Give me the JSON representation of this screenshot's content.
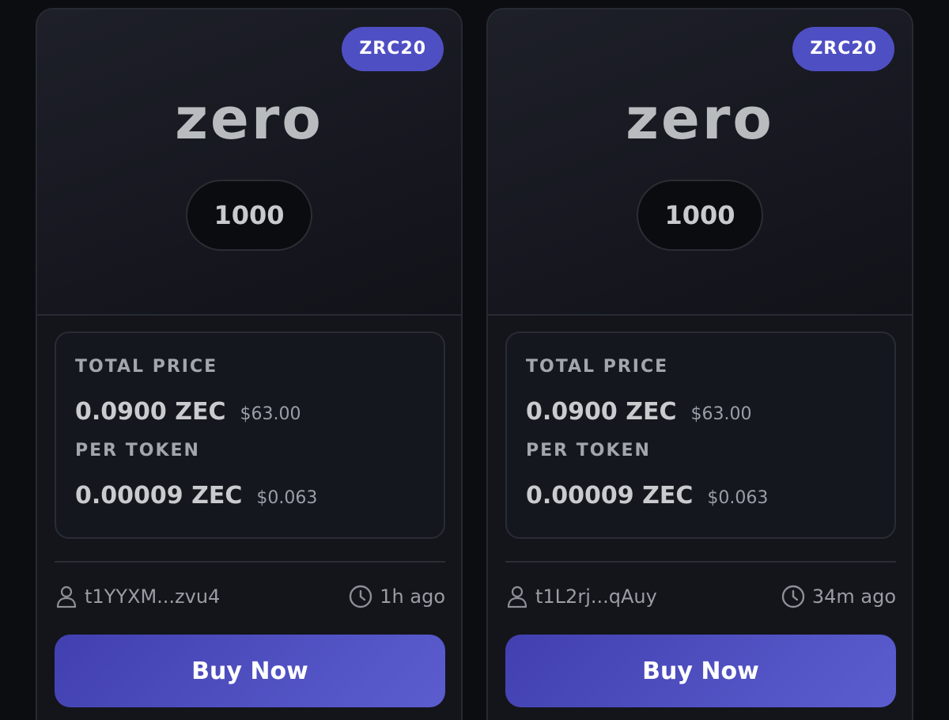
{
  "listings": [
    {
      "badge": "ZRC20",
      "ticker": "zero",
      "amount": "1000",
      "total_price_label": "TOTAL PRICE",
      "total_price_zec": "0.0900 ZEC",
      "total_price_usd": "$63.00",
      "per_token_label": "PER TOKEN",
      "per_token_zec": "0.00009 ZEC",
      "per_token_usd": "$0.063",
      "owner": "t1YYXM...zvu4",
      "listed_ago": "1h ago",
      "buy_label": "Buy Now"
    },
    {
      "badge": "ZRC20",
      "ticker": "zero",
      "amount": "1000",
      "total_price_label": "TOTAL PRICE",
      "total_price_zec": "0.0900 ZEC",
      "total_price_usd": "$63.00",
      "per_token_label": "PER TOKEN",
      "per_token_zec": "0.00009 ZEC",
      "per_token_usd": "$0.063",
      "owner": "t1L2rj...qAuy",
      "listed_ago": "34m ago",
      "buy_label": "Buy Now"
    }
  ],
  "icons": {
    "owner": "user-icon",
    "time": "clock-icon"
  },
  "colors": {
    "accent": "#4f4fc4",
    "button_start": "#4240b0",
    "button_end": "#5b5dcf",
    "background": "#0b0d11",
    "card": "#13151b"
  }
}
